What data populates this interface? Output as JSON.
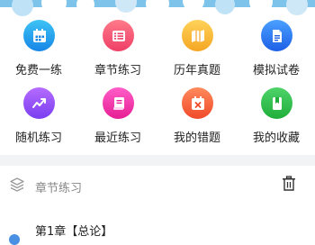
{
  "grid": [
    {
      "label": "免费一练",
      "icon": "calendar-icon",
      "color_top": "#3ec3f5",
      "color_bottom": "#1686e6"
    },
    {
      "label": "章节练习",
      "icon": "list-icon",
      "color_top": "#ff7a8a",
      "color_bottom": "#ef3f66"
    },
    {
      "label": "历年真题",
      "icon": "map-icon",
      "color_top": "#ffd25a",
      "color_bottom": "#f5a623"
    },
    {
      "label": "模拟试卷",
      "icon": "document-icon",
      "color_top": "#4aa0ff",
      "color_bottom": "#1d5fe6"
    },
    {
      "label": "随机练习",
      "icon": "trend-icon",
      "color_top": "#b56bff",
      "color_bottom": "#7a3ff0"
    },
    {
      "label": "最近练习",
      "icon": "book-icon",
      "color_top": "#ff5dc8",
      "color_bottom": "#e61f93"
    },
    {
      "label": "我的错题",
      "icon": "error-calendar-icon",
      "color_top": "#ff8a5c",
      "color_bottom": "#f04a2a"
    },
    {
      "label": "我的收藏",
      "icon": "bookmark-icon",
      "color_top": "#4fd36a",
      "color_bottom": "#1fae3a"
    }
  ],
  "section": {
    "title": "章节练习"
  },
  "chapters": [
    {
      "label": "第1章【总论】"
    }
  ],
  "accent": "#4a90e2"
}
